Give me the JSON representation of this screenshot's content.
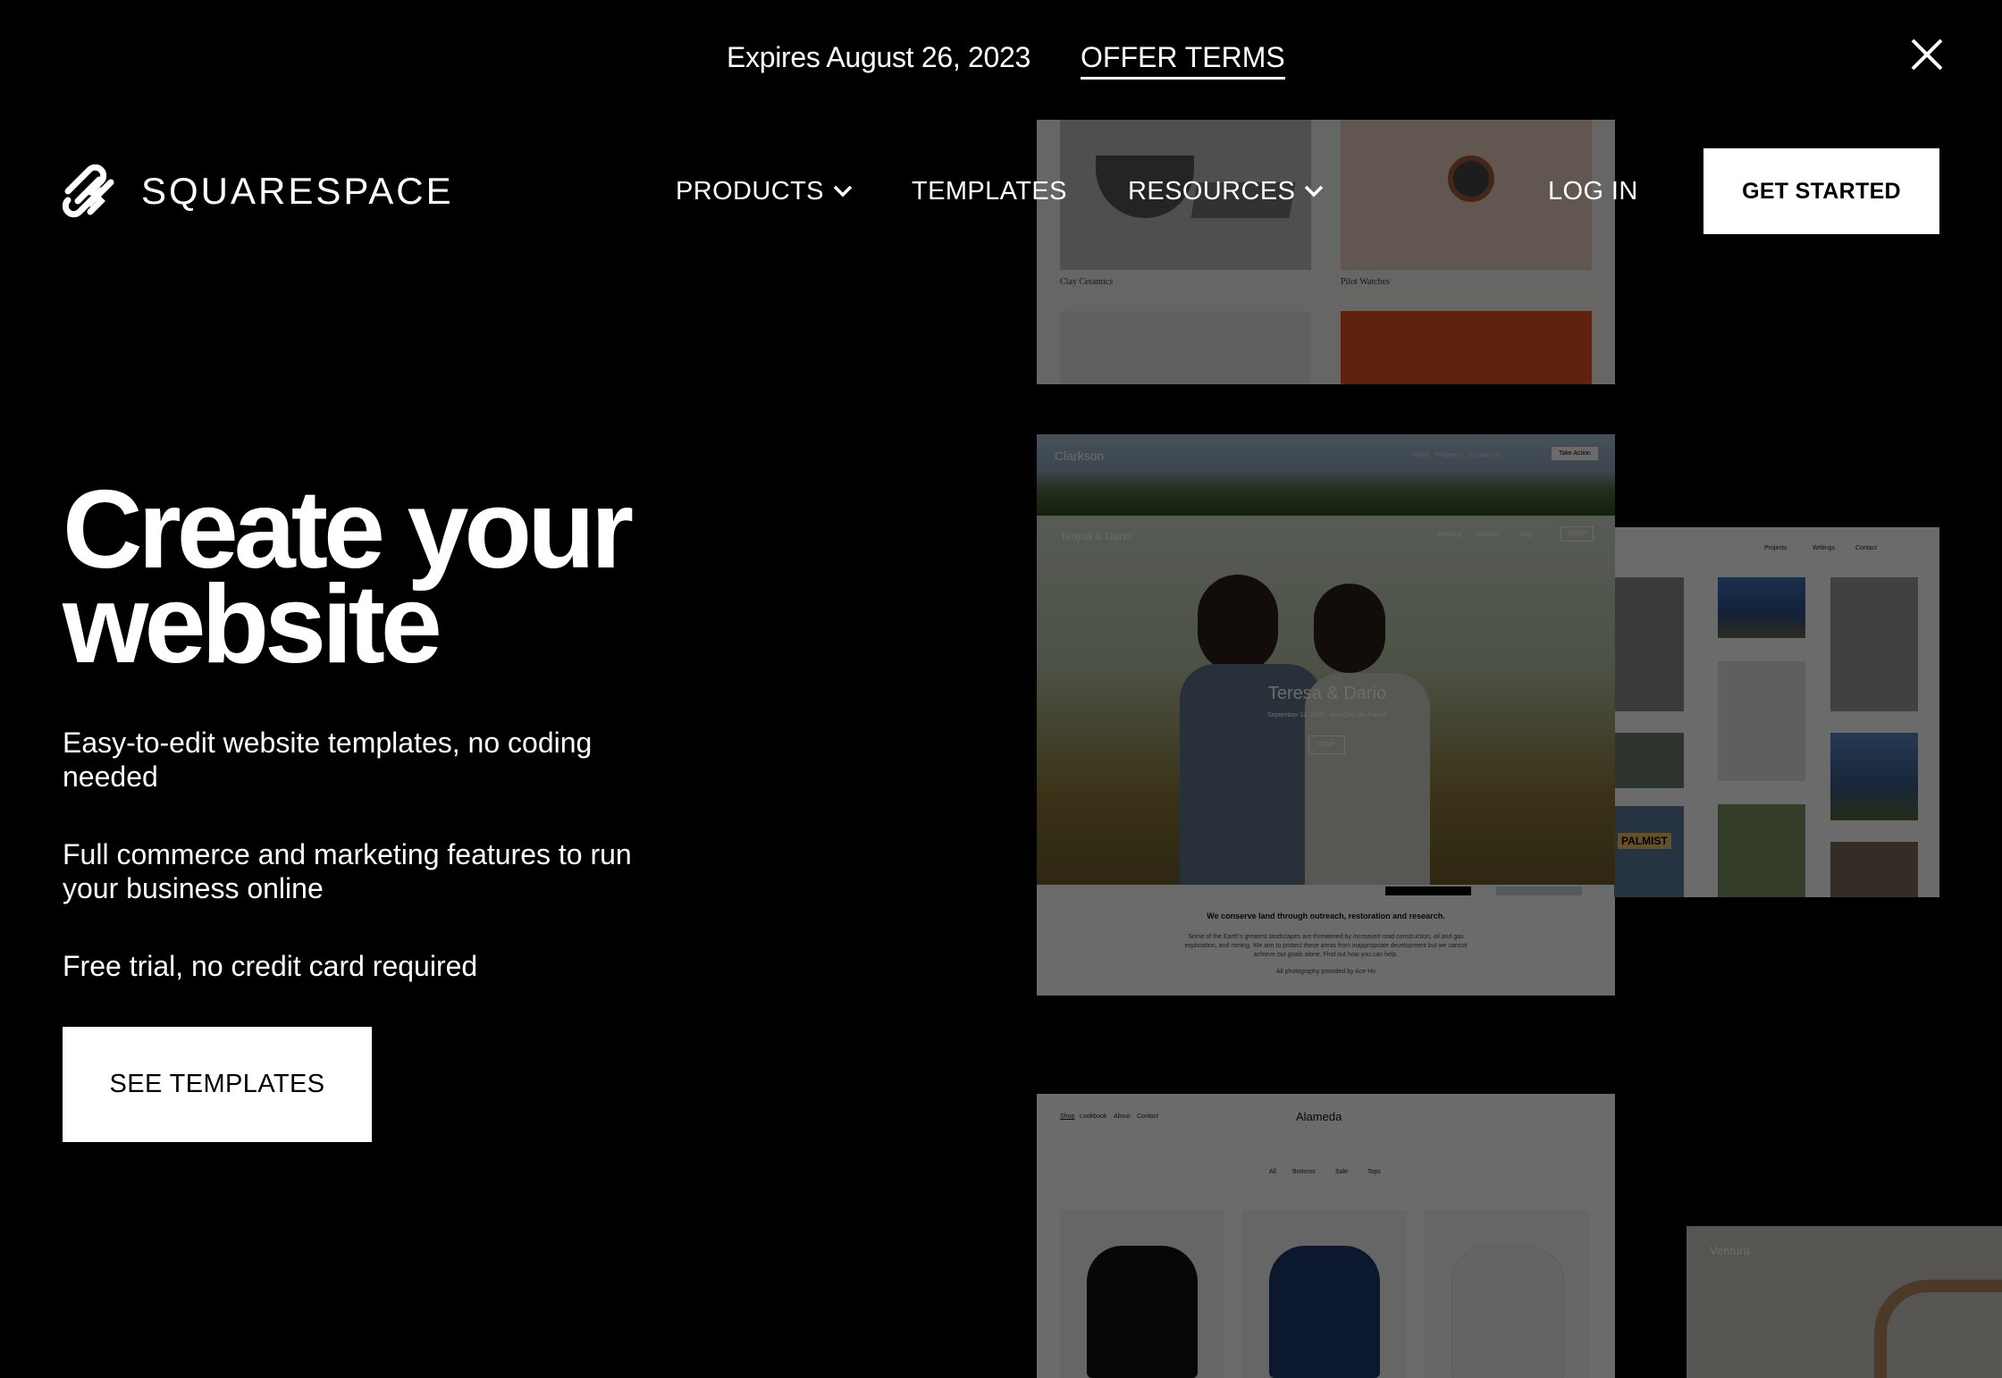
{
  "promo": {
    "expiry_text": "Expires August 26, 2023",
    "terms_link": "OFFER TERMS",
    "close_icon": "close-icon"
  },
  "nav": {
    "logo_text": "SQUARESPACE",
    "logo_icon": "squarespace-logo-icon",
    "products": "PRODUCTS",
    "templates": "TEMPLATES",
    "resources": "RESOURCES",
    "log_in": "LOG IN",
    "get_started": "GET STARTED"
  },
  "hero": {
    "title_line1": "Create your",
    "title_line2": "website",
    "features": [
      "Easy-to-edit website templates, no coding needed",
      "Full commerce and marketing features to run your business online",
      "Free trial, no credit card required"
    ],
    "cta": "SEE TEMPLATES"
  },
  "previews": {
    "shop": {
      "item1": "Clay Ceramics",
      "item2": "Pilot Watches"
    },
    "clarkson": {
      "brand": "Clarkson",
      "nav": [
        "About",
        "Programs",
        "Contact Us"
      ],
      "button": "Take Action",
      "headline": "We conserve land through outreach, restoration and research.",
      "body": "Some of the Earth's greatest landscapes are threatened by increased road construction, oil and gas exploration, and mining. We aim to protect these areas from inappropriate development but we cannot achieve our goals alone. Find out how you can help.",
      "credit": "All photography provided by Ace Ho"
    },
    "wedding": {
      "brand": "Teresa & Dario",
      "nav": [
        "Wedding",
        "Location",
        "FAQ"
      ],
      "button": "RSVP",
      "names": "Teresa & Dario",
      "date": "September 12, 2020 · Isola Del Liri, France",
      "cta": "RSVP"
    },
    "gallery": {
      "nav": [
        "Projects",
        "Writings",
        "Contact"
      ],
      "sign": "PALMIST"
    },
    "alameda": {
      "brand": "Alameda",
      "nav": [
        "Shop",
        "Lookbook",
        "About",
        "Contact"
      ],
      "filters": [
        "All",
        "Bottoms",
        "Sale",
        "Tops"
      ]
    },
    "ventura": {
      "brand": "Ventura"
    }
  },
  "colors": {
    "background": "#000000",
    "text": "#ffffff",
    "button_bg": "#ffffff",
    "button_text": "#000000"
  }
}
